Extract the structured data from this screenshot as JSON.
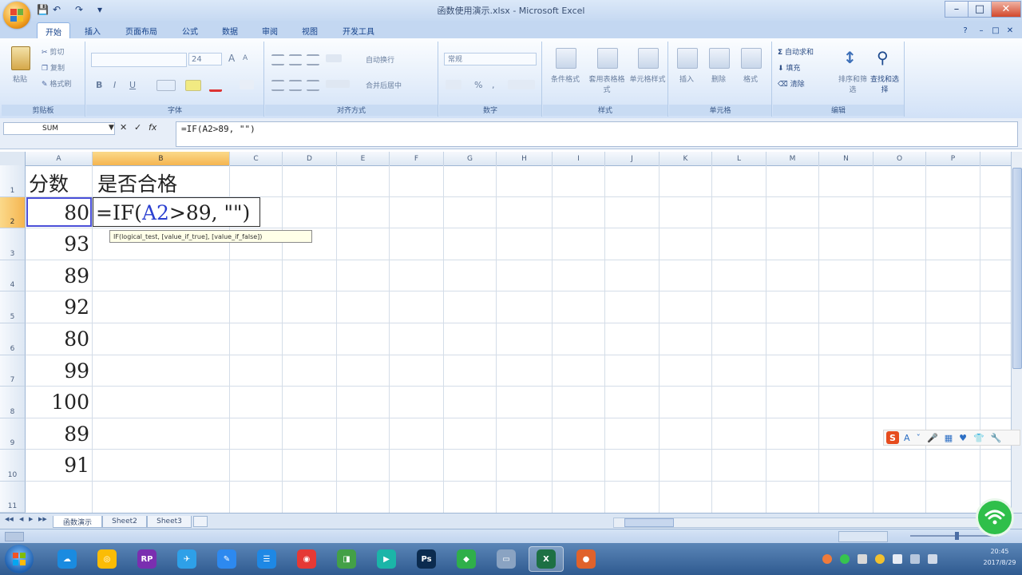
{
  "window": {
    "title": "函数使用演示.xlsx - Microsoft Excel",
    "minimize": "–",
    "maximize": "□",
    "close": "✕",
    "help": "?",
    "wmin": "–",
    "wmax": "□",
    "wclose": "✕"
  },
  "qat": {
    "save": "💾",
    "undo": "↶",
    "redo": "↷",
    "more": "▾"
  },
  "ribbon": {
    "tabs": [
      "开始",
      "插入",
      "页面布局",
      "公式",
      "数据",
      "审阅",
      "视图",
      "开发工具"
    ],
    "active_tab": 0,
    "clipboard": {
      "paste": "粘贴",
      "cut": "剪切",
      "copy": "复制",
      "format_painter": "格式刷",
      "label": "剪贴板"
    },
    "font": {
      "size": "24",
      "grow": "A",
      "shrink": "A",
      "bold": "B",
      "italic": "I",
      "underline": "U",
      "label": "字体"
    },
    "alignment": {
      "wrap": "自动换行",
      "merge": "合并后居中",
      "label": "对齐方式"
    },
    "number": {
      "format": "常规",
      "percent": "%",
      "comma": ",",
      "label": "数字"
    },
    "styles": {
      "conditional": "条件格式",
      "table": "套用表格格式",
      "cell": "单元格样式",
      "label": "样式"
    },
    "cells": {
      "insert": "插入",
      "delete": "删除",
      "format": "格式",
      "label": "单元格"
    },
    "editing": {
      "autosum": "自动求和",
      "fill": "填充",
      "clear": "清除",
      "sort": "排序和筛选",
      "find": "查找和选择",
      "label": "编辑"
    }
  },
  "formula_bar": {
    "name_box": "SUM",
    "cancel": "✕",
    "enter": "✓",
    "fx": "fx",
    "formula": "=IF(A2>89, \"\")"
  },
  "grid": {
    "columns": [
      "A",
      "B",
      "C",
      "D",
      "E",
      "F",
      "G",
      "H",
      "I",
      "J",
      "K",
      "L",
      "M",
      "N",
      "O",
      "P"
    ],
    "rows": [
      "1",
      "2",
      "3",
      "4",
      "5",
      "6",
      "7",
      "8",
      "9",
      "10",
      "11"
    ],
    "selected_column": "B",
    "selected_row": "2",
    "header_a": "分数",
    "header_b": "是否合格",
    "scores": [
      "80",
      "93",
      "89",
      "92",
      "80",
      "99",
      "100",
      "89",
      "91"
    ],
    "editing_formula_parts": [
      "=IF(",
      "A2",
      ">89, \"\")"
    ],
    "tooltip": "IF(logical_test, [value_if_true], [value_if_false])"
  },
  "sheets": {
    "nav": [
      "◀◀",
      "◀",
      "▶",
      "▶▶"
    ],
    "tabs": [
      "函数演示",
      "Sheet2",
      "Sheet3"
    ],
    "active": 0
  },
  "colors": {
    "ribbon_blue": "#c3d7f1",
    "selected_header": "#f5b550",
    "cell_ref_blue": "#2a3fd0"
  },
  "taskbar": {
    "apps": [
      "baidu-netdisk",
      "chrome",
      "axure",
      "xmind",
      "pen-tool",
      "task-list",
      "netease-music",
      "iqiyi",
      "video-player",
      "photoshop",
      "visio-like",
      "slides",
      "excel",
      "screen-recorder"
    ]
  },
  "clock": {
    "time": "20:45",
    "date": "2017/8/29"
  },
  "ime": {
    "logo": "S",
    "items": [
      "A",
      "ˇ",
      "🎤",
      "▦",
      "♥",
      "👕",
      "🔧"
    ]
  }
}
